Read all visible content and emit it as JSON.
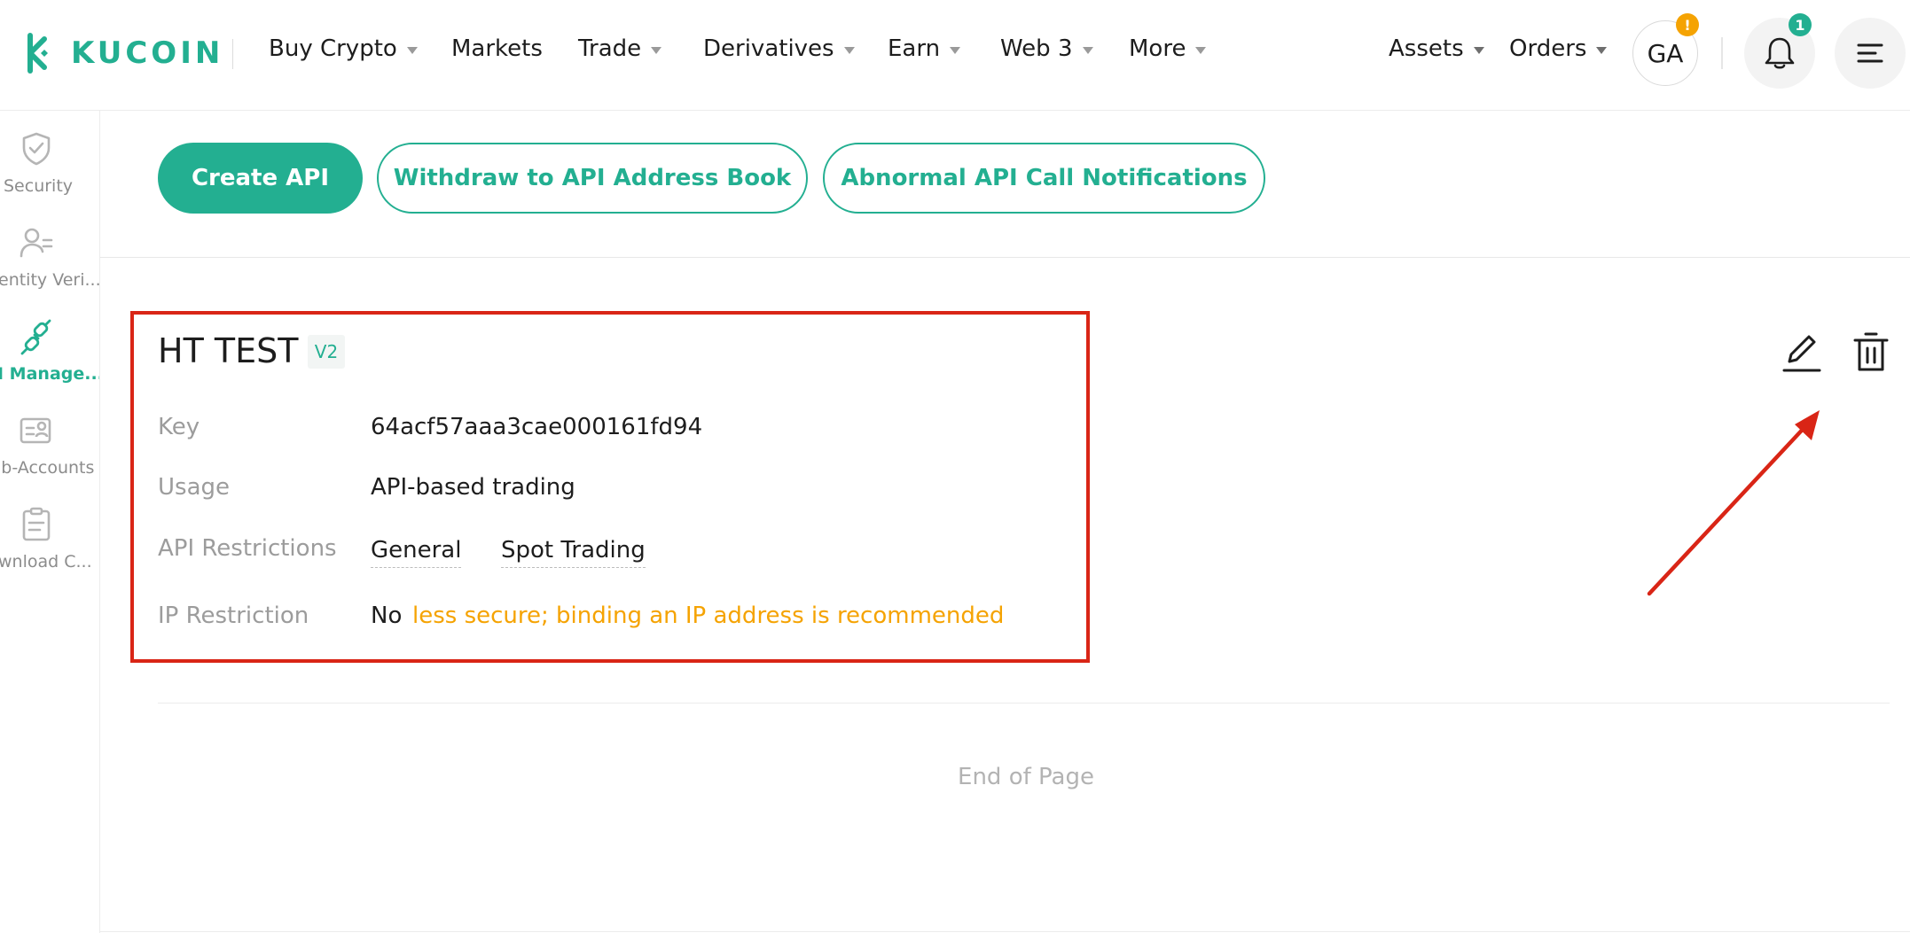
{
  "brand": {
    "name": "KUCOIN",
    "color": "#23af91"
  },
  "nav": {
    "items": [
      {
        "label": "Buy Crypto",
        "has_caret": true
      },
      {
        "label": "Markets",
        "has_caret": false
      },
      {
        "label": "Trade",
        "has_caret": true
      },
      {
        "label": "Derivatives",
        "has_caret": true
      },
      {
        "label": "Earn",
        "has_caret": true
      },
      {
        "label": "Web 3",
        "has_caret": true
      },
      {
        "label": "More",
        "has_caret": true
      }
    ],
    "assets_label": "Assets",
    "orders_label": "Orders",
    "avatar_initials": "GA",
    "avatar_badge": "!",
    "notification_count": "1",
    "icons": {
      "bell": "bell-icon",
      "menu": "hamburger-menu-icon"
    }
  },
  "sidebar": {
    "items": [
      {
        "label": "Security",
        "icon": "shield-check-icon",
        "active": false
      },
      {
        "label": "entity Veri...",
        "icon": "user-id-icon",
        "active": false
      },
      {
        "label": "I Manage...",
        "icon": "api-plug-icon",
        "active": true
      },
      {
        "label": "ib-Accounts",
        "icon": "sub-accounts-icon",
        "active": false
      },
      {
        "label": "wnload C...",
        "icon": "clipboard-icon",
        "active": false
      }
    ]
  },
  "actions": {
    "create_api": "Create API",
    "withdraw_address_book": "Withdraw to API Address Book",
    "abnormal_notifications": "Abnormal API Call Notifications"
  },
  "api_card": {
    "name": "HT TEST",
    "version": "V2",
    "key_label": "Key",
    "key_value": "64acf57aaa3cae000161fd94",
    "usage_label": "Usage",
    "usage_value": "API-based trading",
    "restrictions_label": "API Restrictions",
    "restrictions": [
      "General",
      "Spot Trading"
    ],
    "ip_label": "IP Restriction",
    "ip_value": "No",
    "ip_warning": "less secure; binding an IP address is recommended",
    "edit_icon": "edit-pencil-icon",
    "delete_icon": "trash-icon"
  },
  "footer": {
    "end_of_page": "End of Page"
  },
  "colors": {
    "accent": "#23af91",
    "warning": "#f5a302",
    "highlight": "#d92516",
    "badge_orange": "#f5a302"
  }
}
